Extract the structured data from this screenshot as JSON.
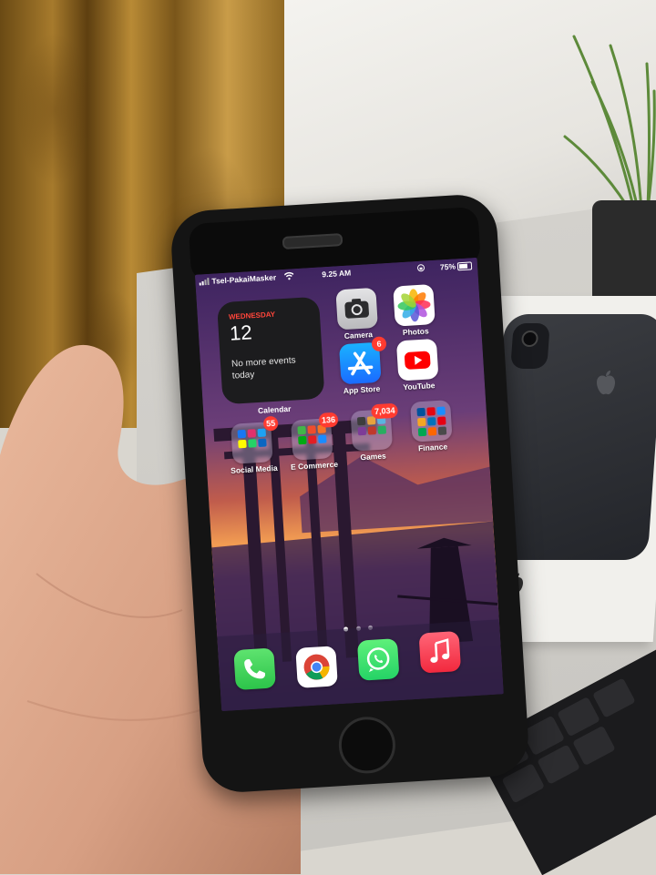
{
  "status_bar": {
    "carrier": "Tsel-PakaiMasker",
    "time": "9.25 AM",
    "battery_percent": "75%",
    "battery_level": 0.75
  },
  "widget": {
    "day": "WEDNESDAY",
    "date": "12",
    "events_text": "No more events today",
    "label": "Calendar"
  },
  "apps": {
    "camera": {
      "label": "Camera",
      "icon": "camera-icon"
    },
    "photos": {
      "label": "Photos",
      "icon": "photos-icon"
    },
    "app_store": {
      "label": "App Store",
      "icon": "app-store-icon",
      "badge": "6"
    },
    "youtube": {
      "label": "YouTube",
      "icon": "youtube-icon"
    }
  },
  "folders": {
    "social_media": {
      "label": "Social Media",
      "badge": "55"
    },
    "e_commerce": {
      "label": "E Commerce",
      "badge": "136"
    },
    "games": {
      "label": "Games",
      "badge": "7,034"
    },
    "finance": {
      "label": "Finance"
    }
  },
  "dock": [
    "phone-icon",
    "chrome-icon",
    "whatsapp-icon",
    "music-icon"
  ],
  "page_indicator": {
    "pages": 3,
    "current": 1
  },
  "colors": {
    "badge": "#ff3b30",
    "calendar_day": "#ff453a",
    "phone_green": "#34c759",
    "whatsapp_green": "#25d366",
    "youtube_red": "#ff0000",
    "music_red": "#fa3c4c",
    "app_store_blue": "#1a8cff"
  }
}
